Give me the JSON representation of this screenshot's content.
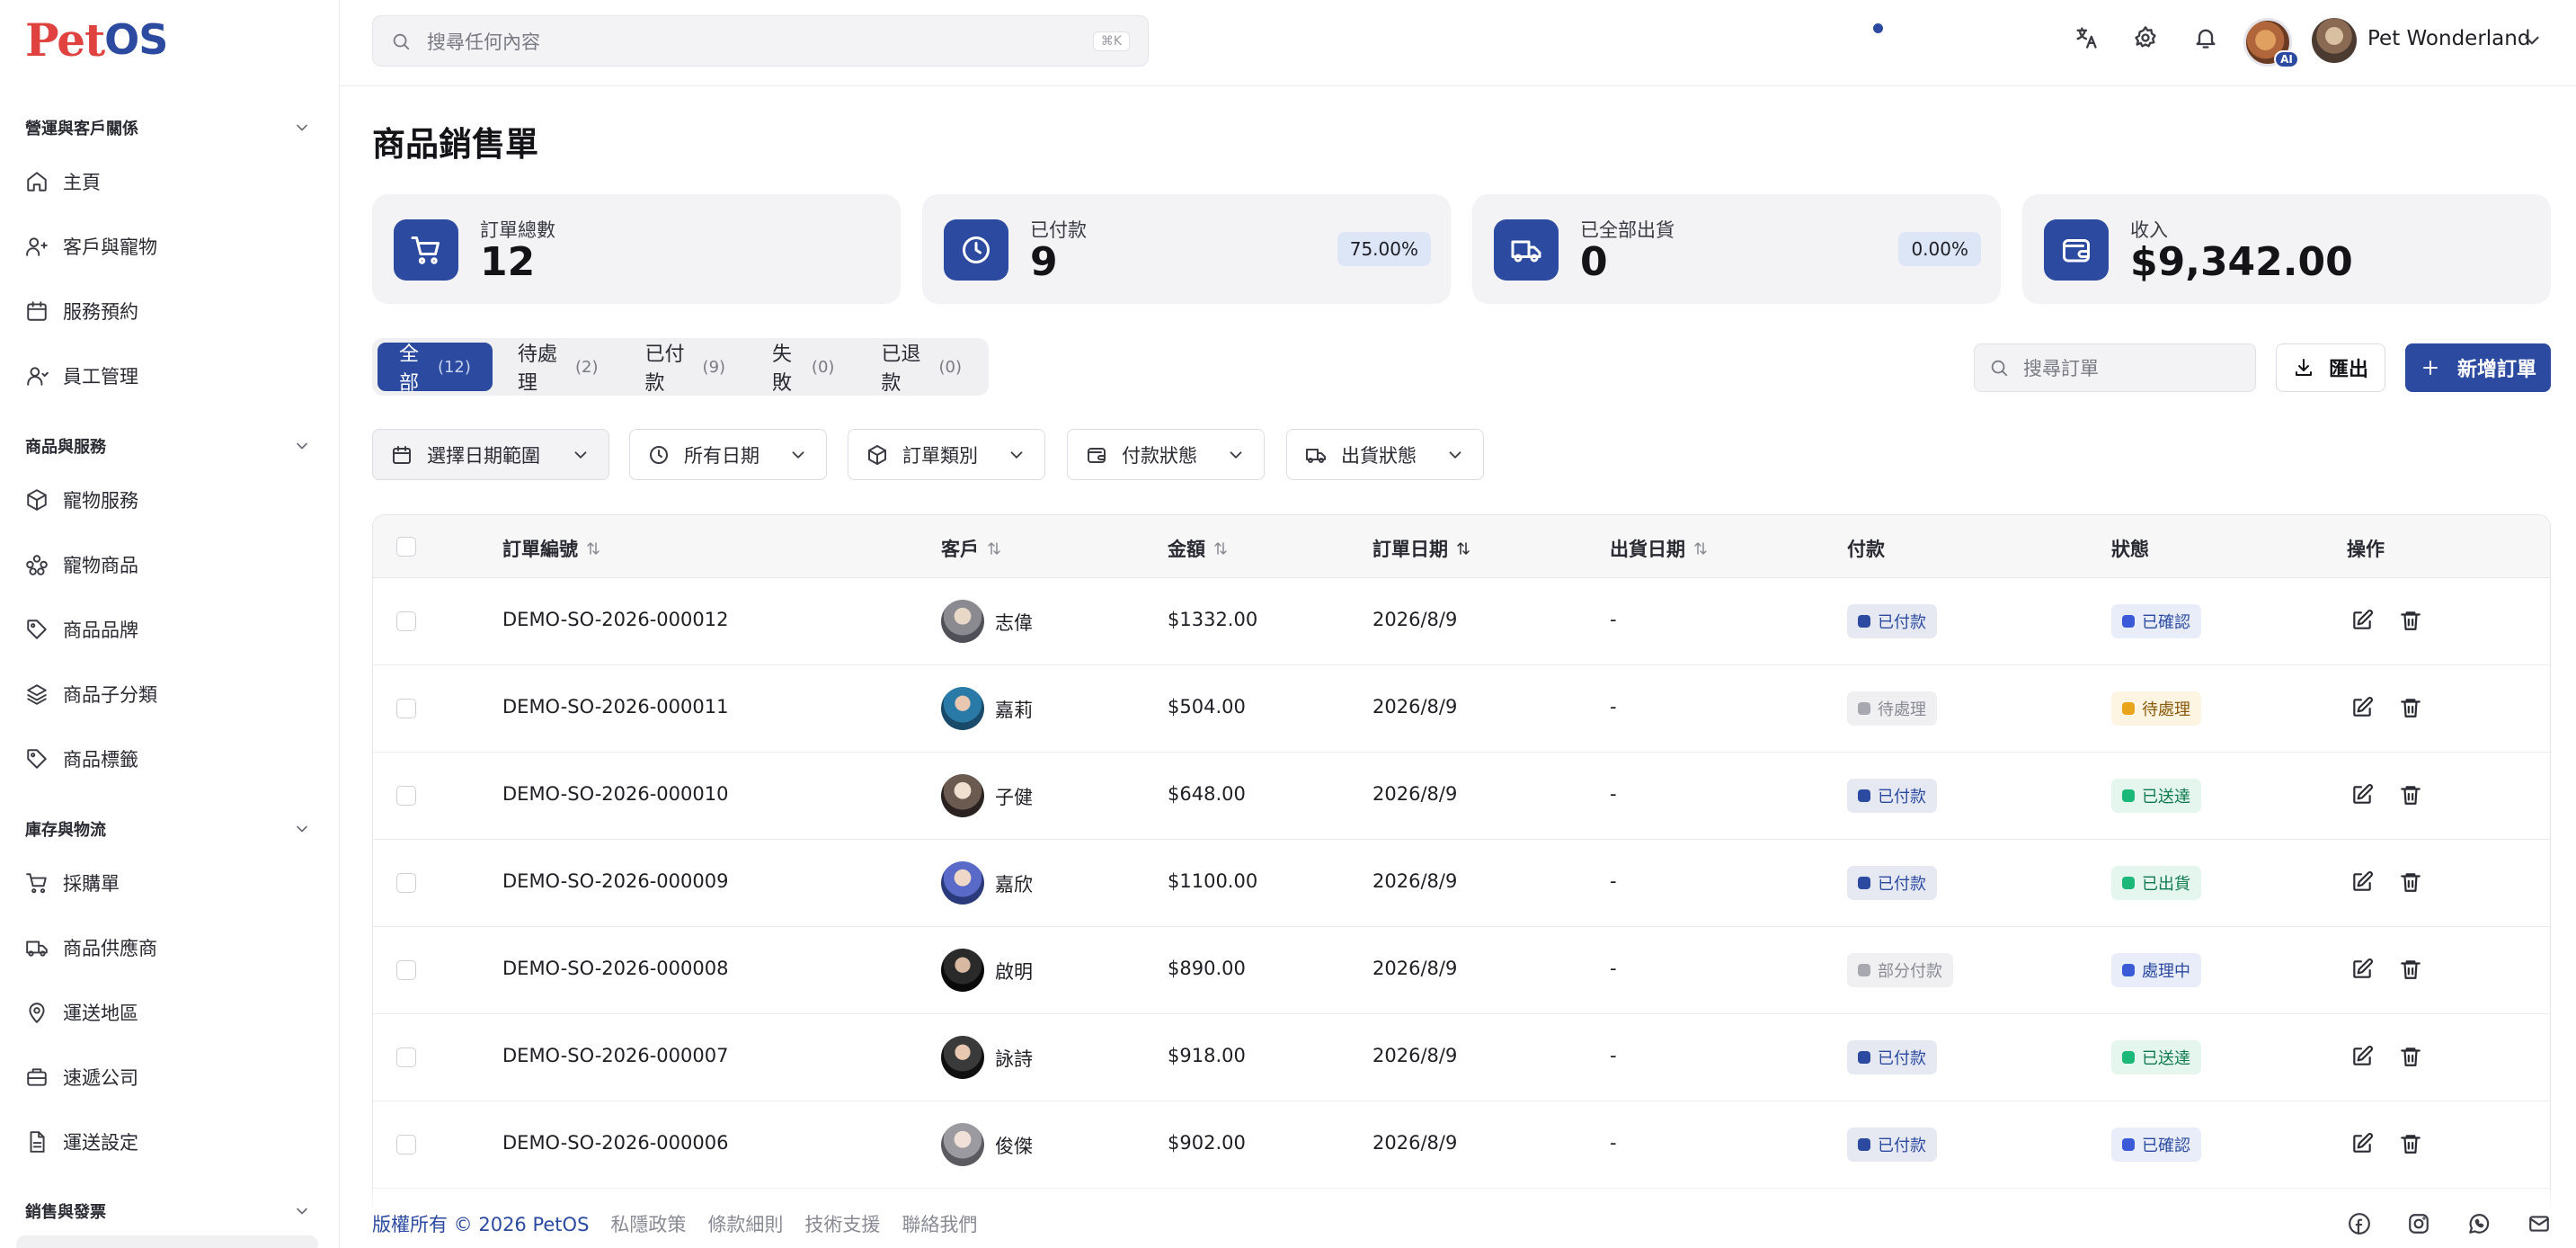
{
  "app": {
    "logo_pet": "Pet",
    "logo_os": "OS"
  },
  "sidebar": {
    "sections": [
      {
        "label": "營運與客戶關係"
      },
      {
        "label": "商品與服務"
      },
      {
        "label": "庫存與物流"
      },
      {
        "label": "銷售與發票"
      }
    ],
    "items": [
      {
        "label": "主頁",
        "icon": "home-icon"
      },
      {
        "label": "客戶與寵物",
        "icon": "users-icon"
      },
      {
        "label": "服務預約",
        "icon": "calendar-icon"
      },
      {
        "label": "員工管理",
        "icon": "user-icon"
      },
      {
        "label": "寵物服務",
        "icon": "package-icon"
      },
      {
        "label": "寵物商品",
        "icon": "paw-icon"
      },
      {
        "label": "商品品牌",
        "icon": "tag-icon"
      },
      {
        "label": "商品子分類",
        "icon": "layers-icon"
      },
      {
        "label": "商品標籤",
        "icon": "tag-icon"
      },
      {
        "label": "採購單",
        "icon": "cart-icon"
      },
      {
        "label": "商品供應商",
        "icon": "truck-icon"
      },
      {
        "label": "運送地區",
        "icon": "map-pin-icon"
      },
      {
        "label": "速遞公司",
        "icon": "briefcase-icon"
      },
      {
        "label": "運送設定",
        "icon": "file-icon"
      }
    ]
  },
  "header": {
    "search_placeholder": "搜尋任何內容",
    "search_shortcut": "⌘K",
    "ai_badge": "AI",
    "user_name": "Pet Wonderland"
  },
  "page": {
    "title": "商品銷售單"
  },
  "stats": [
    {
      "label": "訂單總數",
      "value": "12",
      "pct": "",
      "icon": "cart-icon"
    },
    {
      "label": "已付款",
      "value": "9",
      "pct": "75.00%",
      "icon": "clock-icon"
    },
    {
      "label": "已全部出貨",
      "value": "0",
      "pct": "0.00%",
      "icon": "truck-icon"
    },
    {
      "label": "收入",
      "value": "$9,342.00",
      "pct": "",
      "icon": "wallet-icon"
    }
  ],
  "tabs": [
    {
      "label": "全部",
      "count": "(12)",
      "active": true
    },
    {
      "label": "待處理",
      "count": "(2)"
    },
    {
      "label": "已付款",
      "count": "(9)"
    },
    {
      "label": "失敗",
      "count": "(0)"
    },
    {
      "label": "已退款",
      "count": "(0)"
    }
  ],
  "toolbar": {
    "search_placeholder": "搜尋訂單",
    "export_label": "匯出",
    "new_label": "新增訂單"
  },
  "filters": [
    {
      "label": "選擇日期範圍",
      "icon": "calendar-icon"
    },
    {
      "label": "所有日期",
      "icon": "clock-icon"
    },
    {
      "label": "訂單類別",
      "icon": "box-icon"
    },
    {
      "label": "付款狀態",
      "icon": "wallet-icon"
    },
    {
      "label": "出貨狀態",
      "icon": "truck-icon"
    }
  ],
  "table": {
    "headers": {
      "order_no": "訂單編號",
      "customer": "客戶",
      "amount": "金額",
      "order_date": "訂單日期",
      "ship_date": "出貨日期",
      "payment": "付款",
      "status": "狀態",
      "actions": "操作"
    },
    "rows": [
      {
        "order_no": "DEMO-SO-2026-000012",
        "customer": "志偉",
        "amount": "$1332.00",
        "order_date": "2026/8/9",
        "ship_date": "-",
        "payment": "已付款",
        "payment_kind": "paid",
        "status": "已確認",
        "status_kind": "blue"
      },
      {
        "order_no": "DEMO-SO-2026-000011",
        "customer": "嘉莉",
        "amount": "$504.00",
        "order_date": "2026/8/9",
        "ship_date": "-",
        "payment": "待處理",
        "payment_kind": "grey",
        "status": "待處理",
        "status_kind": "amber"
      },
      {
        "order_no": "DEMO-SO-2026-000010",
        "customer": "子健",
        "amount": "$648.00",
        "order_date": "2026/8/9",
        "ship_date": "-",
        "payment": "已付款",
        "payment_kind": "paid",
        "status": "已送達",
        "status_kind": "green"
      },
      {
        "order_no": "DEMO-SO-2026-000009",
        "customer": "嘉欣",
        "amount": "$1100.00",
        "order_date": "2026/8/9",
        "ship_date": "-",
        "payment": "已付款",
        "payment_kind": "paid",
        "status": "已出貨",
        "status_kind": "green"
      },
      {
        "order_no": "DEMO-SO-2026-000008",
        "customer": "啟明",
        "amount": "$890.00",
        "order_date": "2026/8/9",
        "ship_date": "-",
        "payment": "部分付款",
        "payment_kind": "grey",
        "status": "處理中",
        "status_kind": "blue"
      },
      {
        "order_no": "DEMO-SO-2026-000007",
        "customer": "詠詩",
        "amount": "$918.00",
        "order_date": "2026/8/9",
        "ship_date": "-",
        "payment": "已付款",
        "payment_kind": "paid",
        "status": "已送達",
        "status_kind": "green"
      },
      {
        "order_no": "DEMO-SO-2026-000006",
        "customer": "俊傑",
        "amount": "$902.00",
        "order_date": "2026/8/9",
        "ship_date": "-",
        "payment": "已付款",
        "payment_kind": "paid",
        "status": "已確認",
        "status_kind": "blue"
      }
    ]
  },
  "footer": {
    "copyright": "版權所有 © 2026 PetOS",
    "links": [
      "私隱政策",
      "條款細則",
      "技術支援",
      "聯絡我們"
    ]
  },
  "colors": {
    "primary": "#2b4aa0",
    "logo_red": "#e0423f",
    "paid_bg": "#e6e9f2",
    "green": "#1cb87a",
    "amber": "#e8a51a"
  }
}
